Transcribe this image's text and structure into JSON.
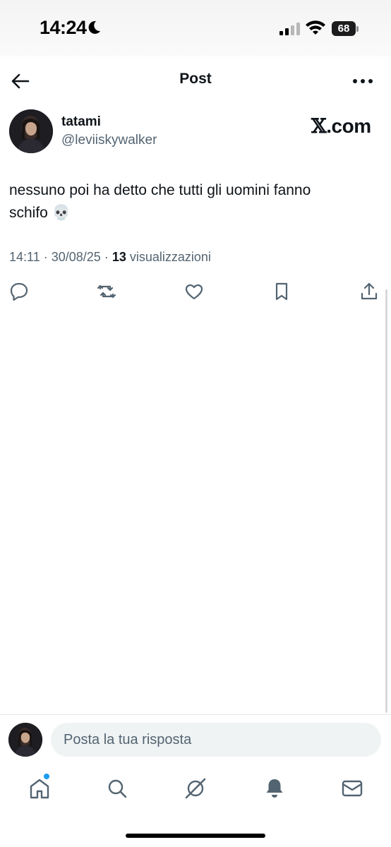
{
  "status_bar": {
    "time": "14:24",
    "battery": "68"
  },
  "header": {
    "title": "Post"
  },
  "post": {
    "author_name": "tatami",
    "author_handle": "@leviiskywalker",
    "source_brand_x": "𝕏",
    "source_brand_suffix": ".com",
    "text_line1": "nessuno poi ha detto che tutti gli uomini fanno",
    "text_line2": "schifo 💀",
    "time": "14:11",
    "date": "30/08/25",
    "views_count": "13",
    "views_label": "visualizzazioni"
  },
  "reply": {
    "placeholder": "Posta la tua risposta"
  },
  "icons": {
    "back": "arrow-left-icon",
    "more": "more-horizontal-icon",
    "reply": "comment-icon",
    "repost": "repost-icon",
    "like": "heart-icon",
    "bookmark": "bookmark-icon",
    "share": "share-icon",
    "home": "home-icon",
    "search": "search-icon",
    "grok": "grok-icon",
    "notifications": "bell-icon",
    "messages": "mail-icon"
  },
  "colors": {
    "accent": "#1d9bf0",
    "secondary_text": "#536471",
    "icon": "#536471"
  }
}
